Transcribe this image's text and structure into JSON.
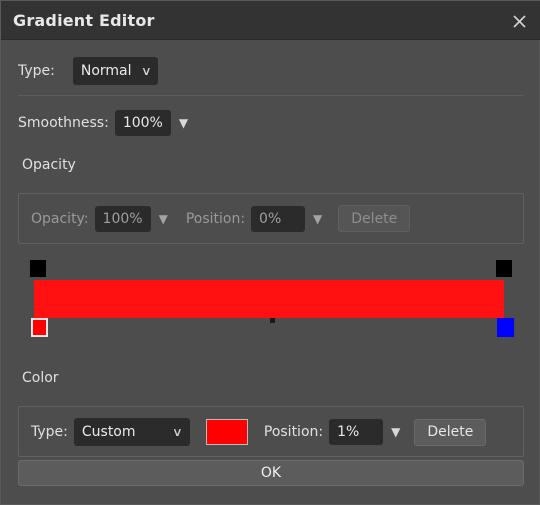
{
  "window": {
    "title": "Gradient Editor",
    "close_icon": "close-icon"
  },
  "type_row": {
    "label": "Type:",
    "value": "Normal",
    "chevron": "∨"
  },
  "smoothness_row": {
    "label": "Smoothness:",
    "value": "100%",
    "spinner": "▼"
  },
  "opacity_section": {
    "heading": "Opacity",
    "opacity_label": "Opacity:",
    "opacity_value": "100%",
    "opacity_spinner": "▼",
    "position_label": "Position:",
    "position_value": "0%",
    "position_spinner": "▼",
    "delete_label": "Delete",
    "enabled": false
  },
  "gradient": {
    "bar_color": "#ff1111",
    "stops": [
      {
        "name": "left-opacity-stop",
        "kind": "opacity",
        "color": "#000000",
        "position": "0%"
      },
      {
        "name": "right-opacity-stop",
        "kind": "opacity",
        "color": "#000000",
        "position": "100%"
      },
      {
        "name": "left-color-stop",
        "kind": "color",
        "color": "#ff0000",
        "position": "1%",
        "selected": true
      },
      {
        "name": "right-color-stop",
        "kind": "color",
        "color": "#0000ff",
        "position": "100%",
        "selected": false
      }
    ],
    "midpoint_marker": "◆"
  },
  "color_section": {
    "heading": "Color",
    "type_label": "Type:",
    "type_value": "Custom",
    "type_chevron": "∨",
    "swatch_color": "#ff0000",
    "position_label": "Position:",
    "position_value": "1%",
    "position_spinner": "▼",
    "delete_label": "Delete",
    "enabled": true
  },
  "footer": {
    "ok_label": "OK"
  }
}
